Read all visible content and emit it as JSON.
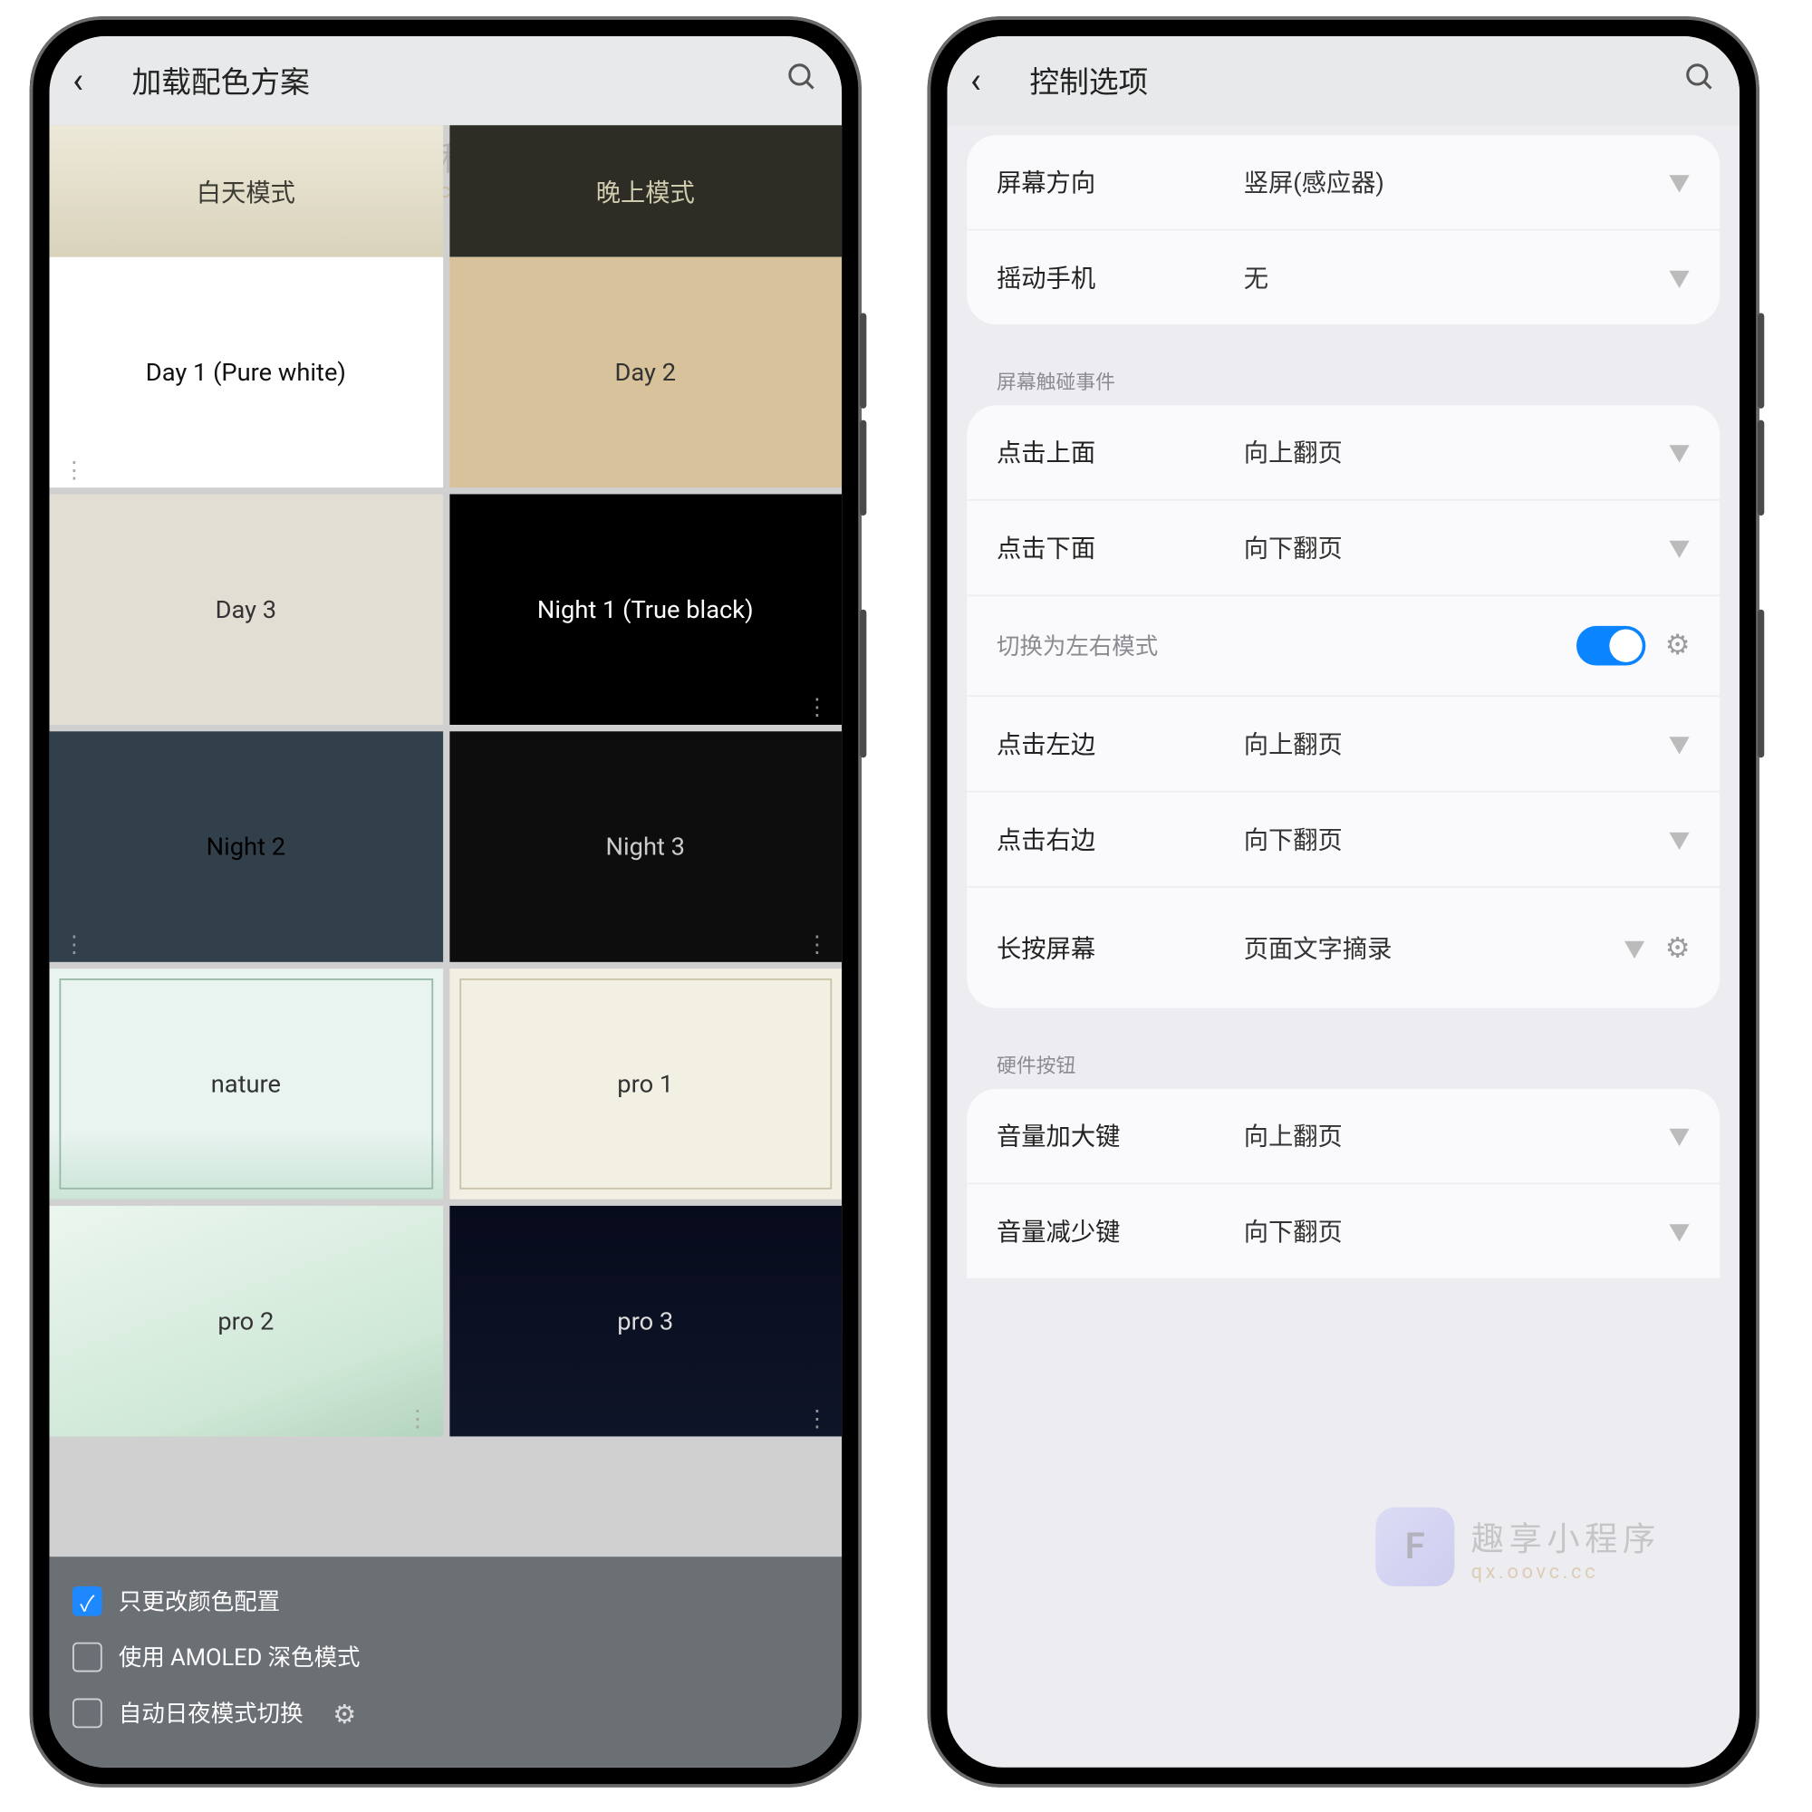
{
  "watermark": {
    "badge": "F",
    "line1": "趣享小程序",
    "line2": "qx.oovc.cc"
  },
  "phoneA": {
    "title": "加载配色方案",
    "tabs": {
      "day": "白天模式",
      "night": "晚上模式"
    },
    "cards": {
      "dayModeHead": "白天模式",
      "nightModeHead": "晚上模式",
      "day1": "Day 1 (Pure white)",
      "day2": "Day 2",
      "day3": "Day 3",
      "night1": "Night 1 (True black)",
      "night2": "Night 2",
      "night3": "Night 3",
      "nature": "nature",
      "pro1": "pro 1",
      "pro2": "pro 2",
      "pro3": "pro 3"
    },
    "options": {
      "onlyColor": "只更改颜色配置",
      "amoled": "使用 AMOLED 深色模式",
      "autoDayNight": "自动日夜模式切换"
    }
  },
  "phoneB": {
    "title": "控制选项",
    "section1": {
      "orientation": {
        "label": "屏幕方向",
        "value": "竖屏(感应器)"
      },
      "shake": {
        "label": "摇动手机",
        "value": "无"
      }
    },
    "section2": {
      "header": "屏幕触碰事件",
      "tapTop": {
        "label": "点击上面",
        "value": "向上翻页"
      },
      "tapBottom": {
        "label": "点击下面",
        "value": "向下翻页"
      },
      "lrMode": {
        "label": "切换为左右模式"
      },
      "tapLeft": {
        "label": "点击左边",
        "value": "向上翻页"
      },
      "tapRight": {
        "label": "点击右边",
        "value": "向下翻页"
      },
      "longPress": {
        "label": "长按屏幕",
        "value": "页面文字摘录"
      }
    },
    "section3": {
      "header": "硬件按钮",
      "volUp": {
        "label": "音量加大键",
        "value": "向上翻页"
      },
      "volDown": {
        "label": "音量减少键",
        "value": "向下翻页"
      }
    }
  }
}
